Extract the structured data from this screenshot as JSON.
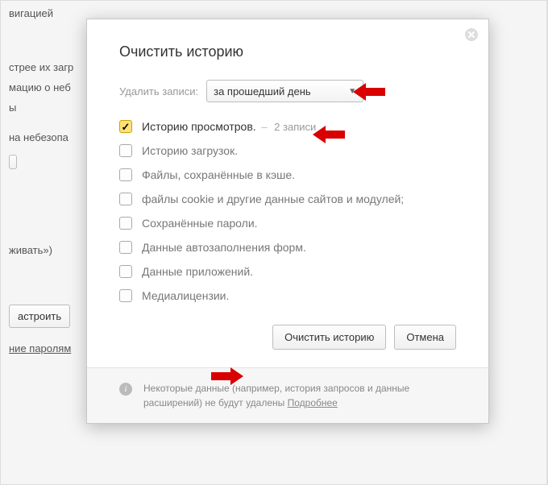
{
  "bg": {
    "line1": "вигацией",
    "line2": "стрее их загр",
    "line3": "мацию о неб",
    "line4": "ы",
    "line5": "на небезопа",
    "line6": "живать»)",
    "button_configure": "астроить",
    "line_passwords": "ние паролям"
  },
  "dialog": {
    "title": "Очистить историю",
    "period_label": "Удалить записи:",
    "period_value": "за прошедший день",
    "checks": [
      {
        "label": "Историю просмотров.",
        "checked": true,
        "extra": "2 записи"
      },
      {
        "label": "Историю загрузок.",
        "checked": false
      },
      {
        "label": "Файлы, сохранённые в кэше.",
        "checked": false
      },
      {
        "label": "файлы cookie и другие данные сайтов и модулей;",
        "checked": false
      },
      {
        "label": "Сохранённые пароли.",
        "checked": false
      },
      {
        "label": "Данные автозаполнения форм.",
        "checked": false
      },
      {
        "label": "Данные приложений.",
        "checked": false
      },
      {
        "label": "Медиалицензии.",
        "checked": false
      }
    ],
    "submit": "Очистить историю",
    "cancel": "Отмена",
    "footer": {
      "text": "Некоторые данные (например, история запросов и данные расширений) не будут удалены",
      "more": "Подробнее"
    }
  },
  "arrow_color": "#d80000"
}
